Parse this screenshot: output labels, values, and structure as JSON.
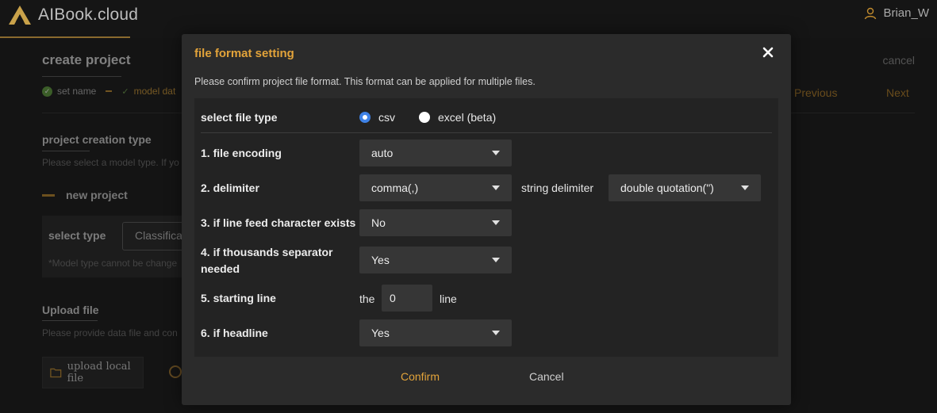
{
  "app": {
    "name": "AIBook.cloud",
    "user": "Brian_W"
  },
  "background": {
    "title": "create project",
    "cancel": "cancel",
    "steps": [
      "set name",
      "model dat"
    ],
    "previous": "Previous",
    "next": "Next",
    "creation_type_title": "project creation type",
    "creation_type_sub": "Please select a model type. If yo",
    "new_project": "new project",
    "select_type_label": "select type",
    "select_type_value": "Classifica",
    "select_type_note": "*Model type cannot be change",
    "upload_title": "Upload file",
    "upload_sub": "Please provide data file and con",
    "upload_button": "upload local file"
  },
  "modal": {
    "title": "file format setting",
    "description": "Please confirm project file format. This format can be applied for multiple files.",
    "file_type": {
      "label": "select file type",
      "options": [
        "csv",
        "excel (beta)"
      ],
      "selected": "csv"
    },
    "encoding": {
      "label": "1. file encoding",
      "value": "auto"
    },
    "delimiter": {
      "label": "2. delimiter",
      "value": "comma(,)",
      "string_label": "string delimiter",
      "string_value": "double quotation(\")"
    },
    "line_feed": {
      "label": "3. if line feed character exists",
      "value": "No"
    },
    "thousands": {
      "label_line1": "4. if thousands separator",
      "label_line2": "needed",
      "value": "Yes"
    },
    "starting_line": {
      "label": "5. starting line",
      "prefix": "the",
      "value": "0",
      "suffix": "line"
    },
    "headline": {
      "label": "6. if headline",
      "value": "Yes"
    },
    "confirm": "Confirm",
    "cancel": "Cancel"
  },
  "colors": {
    "accent": "#e2a33a",
    "radio_selected": "#3f82e6",
    "background": "#1a1a1a",
    "modal": "#2b2b2b"
  }
}
